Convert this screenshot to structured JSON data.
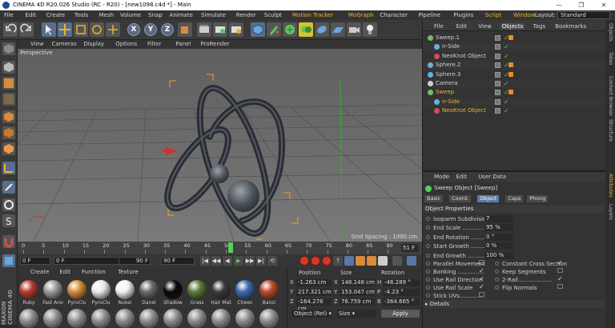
{
  "window": {
    "title": "CINEMA 4D R20.026 Studio (RC - R20) - [new1098.c4d *] - Main",
    "buttons": [
      "—",
      "❐",
      "✕"
    ]
  },
  "menubar": {
    "items": [
      "File",
      "Edit",
      "Create",
      "Tools",
      "Mesh",
      "Volume",
      "Snap",
      "Animate",
      "Simulate",
      "Render",
      "Sculpt",
      "Motion Tracker",
      "MoGraph",
      "Character",
      "Pipeline",
      "Plugins",
      "Script",
      "Window"
    ],
    "highlight": [
      "Motion Tracker",
      "MoGraph",
      "Script",
      "Window"
    ],
    "layout_label": "Layout:",
    "layout_value": "Standard"
  },
  "toolbar": {
    "axis_labels": [
      "X",
      "Y",
      "Z"
    ]
  },
  "viewport": {
    "menu": [
      "View",
      "Cameras",
      "Display",
      "Options",
      "Filter",
      "Panel",
      "ProRender"
    ],
    "label": "Perspective",
    "grid_spacing": "Grid Spacing : 1000 cm"
  },
  "timeline": {
    "ticks": [
      "0",
      "5",
      "10",
      "15",
      "20",
      "25",
      "30",
      "35",
      "40",
      "45",
      "50",
      "55",
      "60",
      "65",
      "70",
      "75",
      "80",
      "85",
      "90"
    ],
    "current": "51",
    "current_frame": "51 F"
  },
  "transport": {
    "start": "0 F",
    "start2": "0 F",
    "end": "90 F",
    "end2": "90 F",
    "play_icons": [
      "|◀",
      "◀◀",
      "◀",
      "▶",
      "▶▶",
      "▶|"
    ]
  },
  "materials": {
    "menu": [
      "Create",
      "Edit",
      "Function",
      "Texture"
    ],
    "items": [
      {
        "name": "Ruby",
        "color": "#b83a2e"
      },
      {
        "name": "Fast Ano",
        "color": "#9a9a9a"
      },
      {
        "name": "PyroClu",
        "color": "#d88b3a"
      },
      {
        "name": "PyroClu",
        "color": "#e8e8e8"
      },
      {
        "name": "Nukei",
        "color": "#f2f2f2"
      },
      {
        "name": "Danel",
        "color": "#6a6a6a"
      },
      {
        "name": "Shadow",
        "color": "#0a0a0a"
      },
      {
        "name": "Grass",
        "color": "#5a7a3a"
      },
      {
        "name": "Hair Mat",
        "color": "#3a3a3a"
      },
      {
        "name": "Cheen",
        "color": "#3a6ab0"
      },
      {
        "name": "Banzi",
        "color": "#b84a2a"
      }
    ]
  },
  "coordinates": {
    "headers": [
      "Position",
      "Size",
      "Rotation"
    ],
    "rows": [
      {
        "axis": "X",
        "pos": "-1.263 cm",
        "size": "148.148 cm",
        "raxis": "H",
        "rot": "-46.289 °"
      },
      {
        "axis": "Y",
        "pos": "217.321 cm",
        "size": "153.047 cm",
        "raxis": "P",
        "rot": "-4.23 °"
      },
      {
        "axis": "Z",
        "pos": "-164.278 cm",
        "size": "76.759 cm",
        "raxis": "B",
        "rot": "-364.665 °"
      }
    ],
    "mode1": "Object (Rel) ▾",
    "mode2": "Size ▾",
    "apply": "Apply"
  },
  "objects": {
    "menu": [
      "File",
      "Edit",
      "View",
      "Objects",
      "Tags",
      "Bookmarks"
    ],
    "rows": [
      {
        "indent": 0,
        "name": "Sweep.1",
        "color": "#d0d0d0",
        "icon": "#7ab86a",
        "chk": "✓",
        "tag": true
      },
      {
        "indent": 1,
        "name": "n-Side",
        "color": "#d0d0d0",
        "icon": "#6ab0e0",
        "chk": "✓",
        "tag": false
      },
      {
        "indent": 1,
        "name": "NeoKnot Object",
        "color": "#d0d0d0",
        "icon": "#d05050",
        "chk": "✓",
        "tag": false
      },
      {
        "indent": 0,
        "name": "Sphere.2",
        "color": "#d0d0d0",
        "icon": "#6ab0e0",
        "chk": "✓",
        "tag": true
      },
      {
        "indent": 0,
        "name": "Sphere.3",
        "color": "#d0d0d0",
        "icon": "#6ab0e0",
        "chk": "✓",
        "tag": true
      },
      {
        "indent": 0,
        "name": "Camera",
        "color": "#d0d0d0",
        "icon": "#cfcfcf",
        "chk": "✓",
        "tag": false
      },
      {
        "indent": 0,
        "name": "Sweep",
        "color": "#f0b030",
        "icon": "#7ab86a",
        "chk": "✓",
        "tag": true
      },
      {
        "indent": 1,
        "name": "n-Side",
        "color": "#f0b030",
        "icon": "#6ab0e0",
        "chk": "✓",
        "tag": false
      },
      {
        "indent": 1,
        "name": "NeoKnot Object",
        "color": "#f0b030",
        "icon": "#d05050",
        "chk": "✓",
        "tag": false
      }
    ]
  },
  "attributes": {
    "menu": [
      "Mode",
      "Edit",
      "User Data"
    ],
    "title": "Sweep Object [Sweep]",
    "tabs": [
      "Basic",
      "Coord.",
      "Object",
      "Caps",
      "Phong"
    ],
    "active_tab": "Object",
    "section": "Object Properties",
    "props": [
      {
        "label": "Isoparm Subdivision",
        "value": "7"
      },
      {
        "label": "End Scale ..............",
        "value": "95 %"
      },
      {
        "label": "End Rotation .........",
        "value": "0 °"
      },
      {
        "label": "Start Growth .........",
        "value": "0 %"
      },
      {
        "label": "End Growth ...........",
        "value": "100 %"
      }
    ],
    "checks_left": [
      {
        "label": "Parallel Movement",
        "checked": false
      },
      {
        "label": "Banking ...............",
        "checked": true
      },
      {
        "label": "Use Rail Direction",
        "checked": true
      },
      {
        "label": "Use Rail Scale",
        "checked": true
      },
      {
        "label": "Stick UVs.............",
        "checked": false
      }
    ],
    "checks_right": [
      {
        "label": "Constant Cross Section",
        "checked": true
      },
      {
        "label": "Keep Segments",
        "checked": false
      },
      {
        "label": "2-Rail...................",
        "checked": true
      },
      {
        "label": "Flip Normals",
        "checked": false
      }
    ],
    "details": "▸ Details"
  },
  "side_tabs": [
    "Objects",
    "Takes",
    "Content Browser",
    "Structure",
    "Attributes",
    "Layers"
  ],
  "brand": {
    "line1": "MAXON",
    "line2": "CINEMA 4D"
  }
}
